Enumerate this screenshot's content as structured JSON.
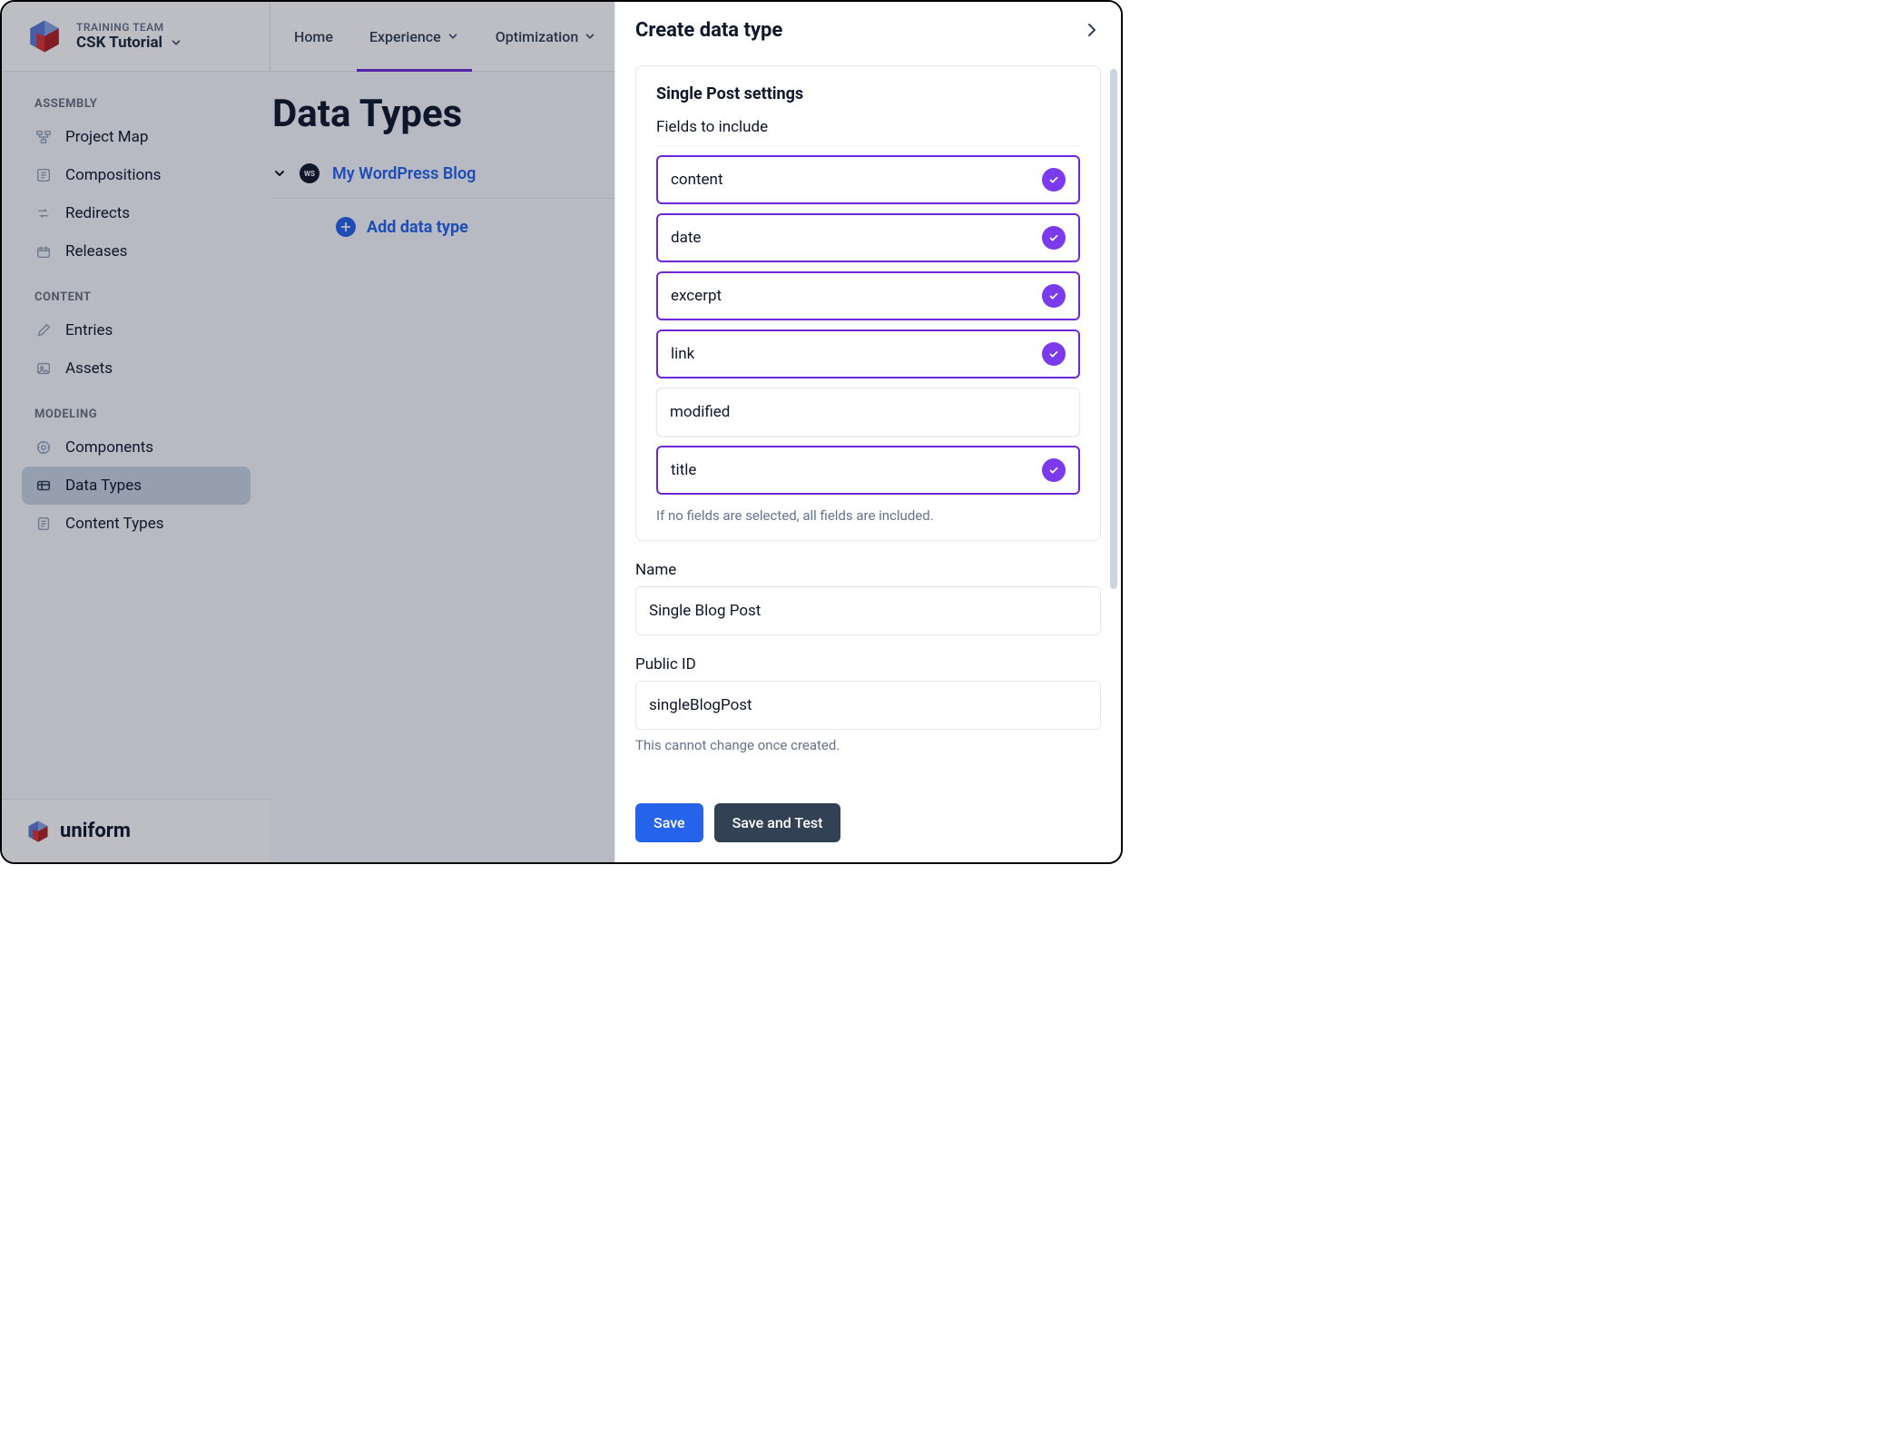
{
  "header": {
    "team_label": "TRAINING TEAM",
    "project_name": "CSK Tutorial",
    "tabs": [
      {
        "label": "Home",
        "active": false,
        "has_dropdown": false
      },
      {
        "label": "Experience",
        "active": true,
        "has_dropdown": true
      },
      {
        "label": "Optimization",
        "active": false,
        "has_dropdown": true
      }
    ]
  },
  "sidebar": {
    "sections": [
      {
        "title": "ASSEMBLY",
        "items": [
          {
            "label": "Project Map",
            "icon": "project-map-icon"
          },
          {
            "label": "Compositions",
            "icon": "compositions-icon"
          },
          {
            "label": "Redirects",
            "icon": "redirects-icon"
          },
          {
            "label": "Releases",
            "icon": "releases-icon"
          }
        ]
      },
      {
        "title": "CONTENT",
        "items": [
          {
            "label": "Entries",
            "icon": "entries-icon"
          },
          {
            "label": "Assets",
            "icon": "assets-icon"
          }
        ]
      },
      {
        "title": "MODELING",
        "items": [
          {
            "label": "Components",
            "icon": "components-icon"
          },
          {
            "label": "Data Types",
            "icon": "data-types-icon",
            "active": true
          },
          {
            "label": "Content Types",
            "icon": "content-types-icon"
          }
        ]
      }
    ]
  },
  "content": {
    "page_title": "Data Types",
    "source_badge": "WS",
    "source_name": "My WordPress Blog",
    "add_button_label": "Add data type"
  },
  "footer": {
    "brand": "uniform"
  },
  "panel": {
    "title": "Create data type",
    "settings_title": "Single Post settings",
    "fields_label": "Fields to include",
    "fields": [
      {
        "label": "content",
        "selected": true
      },
      {
        "label": "date",
        "selected": true
      },
      {
        "label": "excerpt",
        "selected": true
      },
      {
        "label": "link",
        "selected": true
      },
      {
        "label": "modified",
        "selected": false
      },
      {
        "label": "title",
        "selected": true
      }
    ],
    "fields_help": "If no fields are selected, all fields are included.",
    "name_label": "Name",
    "name_value": "Single Blog Post",
    "public_id_label": "Public ID",
    "public_id_value": "singleBlogPost",
    "public_id_help": "This cannot change once created.",
    "save_label": "Save",
    "save_and_test_label": "Save and Test"
  },
  "colors": {
    "accent_purple": "#7c3aed",
    "accent_blue": "#2563eb",
    "slate_dark": "#334155"
  }
}
